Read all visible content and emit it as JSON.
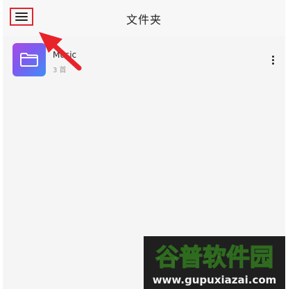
{
  "header": {
    "title": "文件夹",
    "menu_icon": "hamburger-menu-icon",
    "highlight_color": "#e0242b"
  },
  "folders": [
    {
      "name": "Music",
      "count": "3 首",
      "icon": "folder-icon",
      "more_icon": "more-vertical-icon"
    }
  ],
  "annotation": {
    "arrow_icon": "red-arrow",
    "color": "#e8232a"
  },
  "watermark": {
    "brand": "谷普软件园",
    "url": "www.gupuxiazai.com"
  }
}
